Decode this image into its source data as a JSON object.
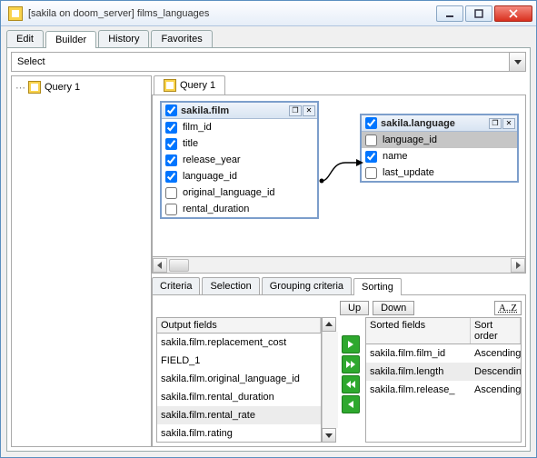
{
  "window": {
    "title": "[sakila on doom_server] films_languages"
  },
  "main_tabs": {
    "t0": "Edit",
    "t1": "Builder",
    "t2": "History",
    "t3": "Favorites",
    "active": 1
  },
  "select_bar": {
    "text": "Select"
  },
  "tree": {
    "node0": "Query 1"
  },
  "canvas_tabs": {
    "t0": "Query 1"
  },
  "film_table": {
    "title": "sakila.film",
    "fields": {
      "f0": {
        "label": "film_id",
        "checked": true
      },
      "f1": {
        "label": "title",
        "checked": true
      },
      "f2": {
        "label": "release_year",
        "checked": true
      },
      "f3": {
        "label": "language_id",
        "checked": true
      },
      "f4": {
        "label": "original_language_id",
        "checked": false
      },
      "f5": {
        "label": "rental_duration",
        "checked": false
      }
    }
  },
  "lang_table": {
    "title": "sakila.language",
    "fields": {
      "f0": {
        "label": "language_id",
        "checked": false,
        "selected": true
      },
      "f1": {
        "label": "name",
        "checked": true
      },
      "f2": {
        "label": "last_update",
        "checked": false
      }
    }
  },
  "lower_tabs": {
    "t0": "Criteria",
    "t1": "Selection",
    "t2": "Grouping criteria",
    "t3": "Sorting",
    "active": 3
  },
  "sort_panel": {
    "up": "Up",
    "down": "Down",
    "az": "A..Z",
    "output_header": "Output fields",
    "output_rows": {
      "r0": "sakila.film.replacement_cost",
      "r1": "FIELD_1",
      "r2": "sakila.film.original_language_id",
      "r3": "sakila.film.rental_duration",
      "r4": "sakila.film.rental_rate",
      "r5": "sakila.film.rating"
    },
    "sorted_header1": "Sorted fields",
    "sorted_header2": "Sort order",
    "sorted_rows": {
      "r0": {
        "field": "sakila.film.film_id",
        "order": "Ascending"
      },
      "r1": {
        "field": "sakila.film.length",
        "order": "Descending"
      },
      "r2": {
        "field": "sakila.film.release_",
        "order": "Ascending"
      }
    }
  }
}
